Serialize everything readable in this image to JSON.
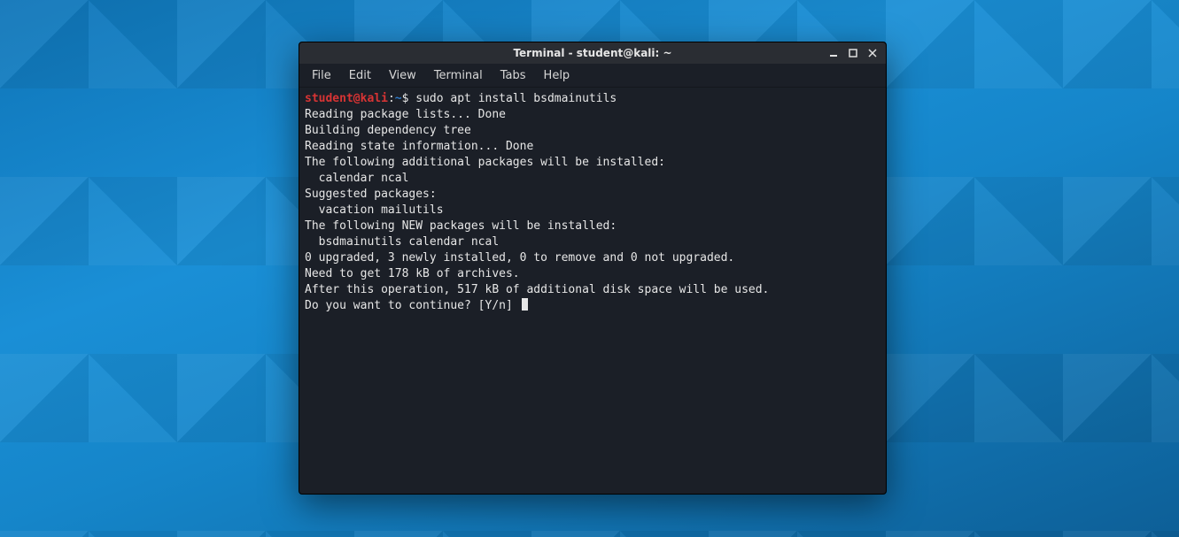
{
  "window": {
    "title": "Terminal - student@kali: ~"
  },
  "menubar": {
    "items": [
      "File",
      "Edit",
      "View",
      "Terminal",
      "Tabs",
      "Help"
    ]
  },
  "prompt": {
    "user": "student",
    "at": "@",
    "host": "kali",
    "colon": ":",
    "path": "~",
    "symbol": "$"
  },
  "terminal": {
    "command": "sudo apt install bsdmainutils",
    "lines": [
      "Reading package lists... Done",
      "Building dependency tree",
      "Reading state information... Done",
      "The following additional packages will be installed:",
      "  calendar ncal",
      "Suggested packages:",
      "  vacation mailutils",
      "The following NEW packages will be installed:",
      "  bsdmainutils calendar ncal",
      "0 upgraded, 3 newly installed, 0 to remove and 0 not upgraded.",
      "Need to get 178 kB of archives.",
      "After this operation, 517 kB of additional disk space will be used.",
      "Do you want to continue? [Y/n] "
    ]
  }
}
